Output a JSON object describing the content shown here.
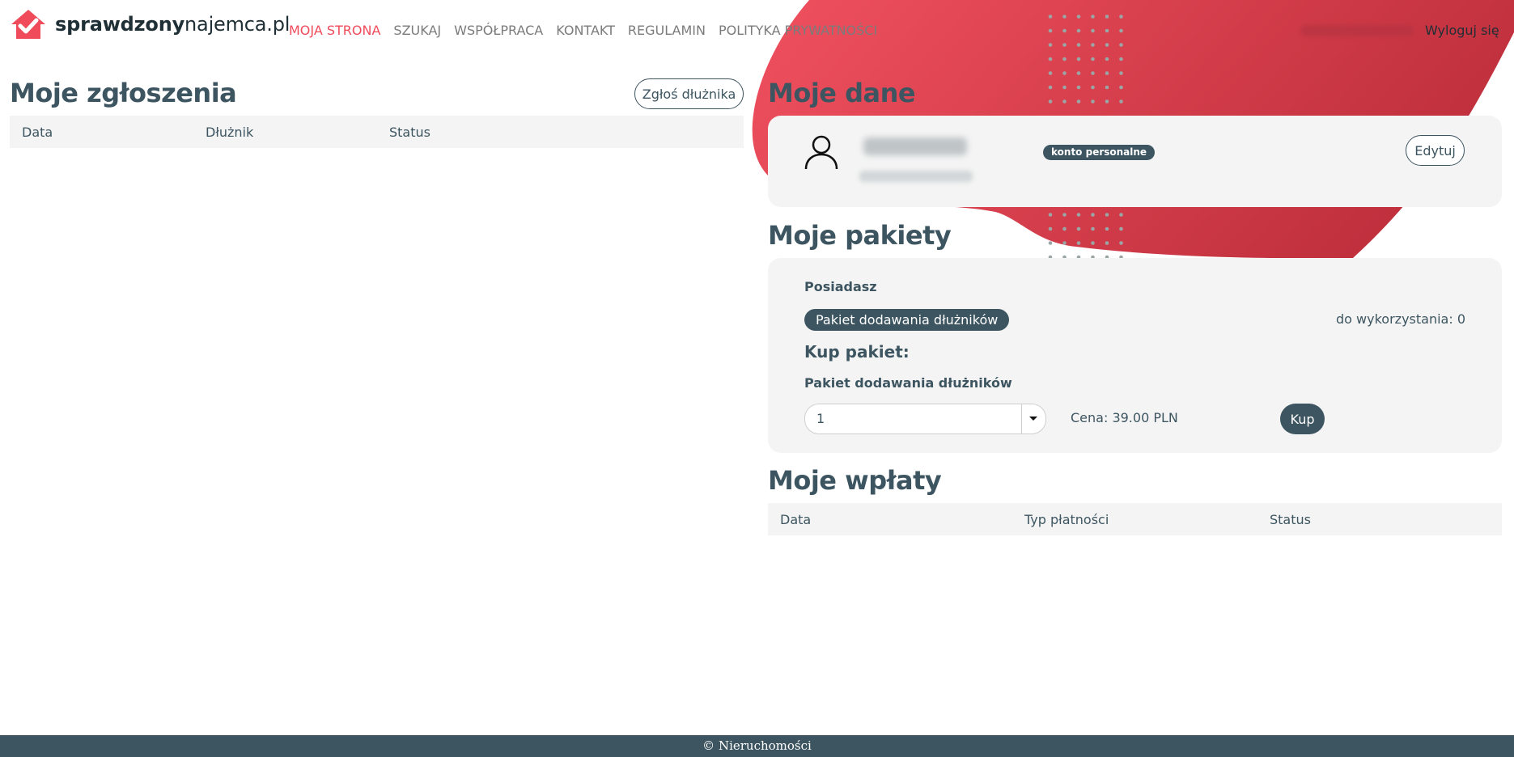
{
  "header": {
    "logo_bold": "sprawdzony",
    "logo_light": "najemca.pl",
    "nav": [
      {
        "label": "MOJA STRONA",
        "active": true
      },
      {
        "label": "SZUKAJ"
      },
      {
        "label": "WSPÓŁPRACA"
      },
      {
        "label": "KONTAKT"
      },
      {
        "label": "REGULAMIN"
      },
      {
        "label": "POLITYKA PRYWATNOŚCI"
      }
    ],
    "logout_label": "Wyloguj się"
  },
  "reports": {
    "title": "Moje zgłoszenia",
    "add_button": "Zgłoś dłużnika",
    "columns": [
      "Data",
      "Dłużnik",
      "Status"
    ]
  },
  "profile": {
    "title": "Moje dane",
    "account_badge": "konto personalne",
    "edit_button": "Edytuj"
  },
  "packages": {
    "title": "Moje pakiety",
    "owned_label": "Posiadasz",
    "owned_package": "Pakiet dodawania dłużników",
    "remaining": "do wykorzystania: 0",
    "buy_title": "Kup pakiet:",
    "buy_package_name": "Pakiet dodawania dłużników",
    "quantity": "1",
    "price": "Cena: 39.00 PLN",
    "buy_button": "Kup"
  },
  "payments": {
    "title": "Moje wpłaty",
    "columns": [
      "Data",
      "Typ płatności",
      "Status"
    ]
  },
  "footer": {
    "copyright": "© Nieruchomości"
  },
  "colors": {
    "accent_red": "#ef4b5b",
    "primary_dark": "#3d5560",
    "panel_bg": "#f4f4f4"
  }
}
